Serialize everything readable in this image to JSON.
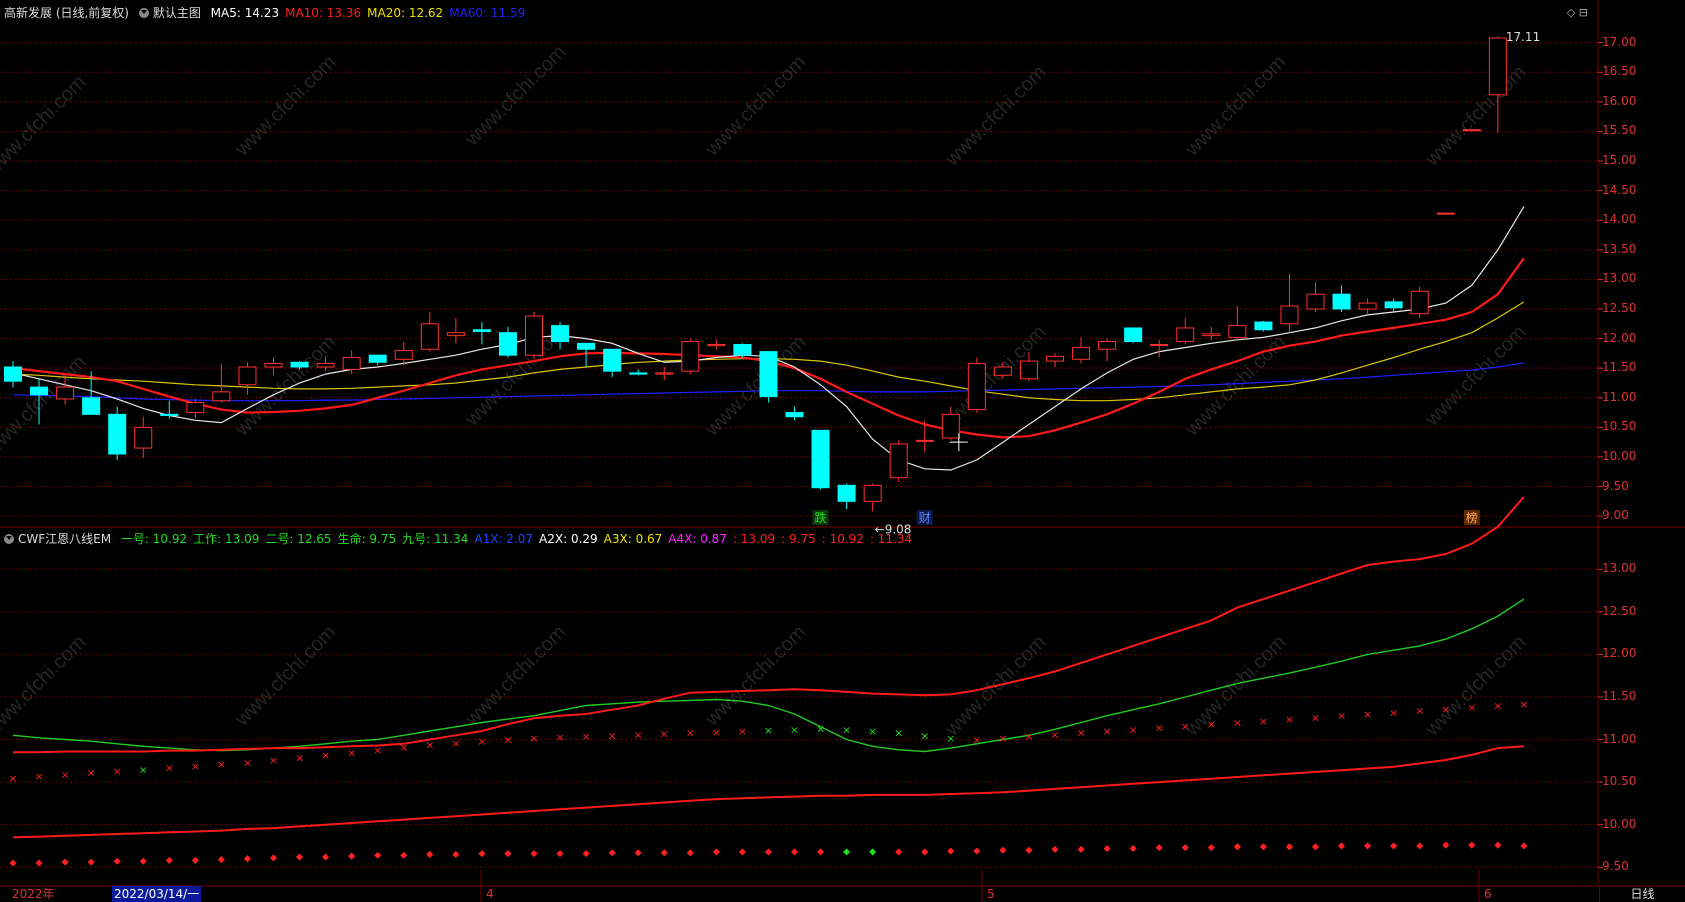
{
  "main": {
    "title": "高新发展 (日线,前复权)",
    "chart_name": "默认主图",
    "ma": [
      {
        "label": "MA5: 14.23",
        "color": "#ffffff"
      },
      {
        "label": "MA10: 13.36",
        "color": "#ff2020"
      },
      {
        "label": "MA20: 12.62",
        "color": "#f0e000"
      },
      {
        "label": "MA60: 11.59",
        "color": "#2020ff"
      }
    ],
    "high_label": "17.11",
    "low_label": "←9.08",
    "markers": [
      "跌",
      "财",
      "榜"
    ],
    "y_ticks": [
      "17.00",
      "16.50",
      "16.00",
      "15.50",
      "15.00",
      "14.50",
      "14.00",
      "13.50",
      "13.00",
      "12.50",
      "12.00",
      "11.50",
      "11.00",
      "10.50",
      "10.00",
      "9.50",
      "9.00"
    ]
  },
  "indicator": {
    "name": "CWF江恩八线EM",
    "values": [
      {
        "label": "一号: 10.92",
        "color": "#22dd22"
      },
      {
        "label": "工作: 13.09",
        "color": "#22dd22"
      },
      {
        "label": "二号: 12.65",
        "color": "#22dd22"
      },
      {
        "label": "生命: 9.75",
        "color": "#22dd22"
      },
      {
        "label": "九号: 11.34",
        "color": "#22dd22"
      },
      {
        "label": "A1X: 2.07",
        "color": "#2244ff"
      },
      {
        "label": "A2X: 0.29",
        "color": "#ffffff"
      },
      {
        "label": "A3X: 0.67",
        "color": "#f0e000"
      },
      {
        "label": "A4X: 0.87",
        "color": "#ff22ff"
      },
      {
        "label": ": 13.09",
        "color": "#ff2020"
      },
      {
        "label": ": 9.75",
        "color": "#ff2020"
      },
      {
        "label": ": 10.92",
        "color": "#ff2020"
      },
      {
        "label": ": 11.34",
        "color": "#ff2020"
      }
    ],
    "y_ticks": [
      "13.00",
      "12.50",
      "12.00",
      "11.50",
      "11.00",
      "10.50",
      "10.00",
      "9.50"
    ]
  },
  "x_axis": {
    "labels": [
      "2022年",
      "2022/03/14/一",
      "4",
      "5",
      "6"
    ],
    "period": "日线"
  },
  "watermark": "www.cfchi.com",
  "colors": {
    "up": "#ff3030",
    "down": "#00ffff",
    "grid": "#7a0000",
    "axis_text": "#d33333"
  },
  "chart_data": {
    "type": "candlestick",
    "candles": [
      {
        "o": 11.52,
        "h": 11.62,
        "l": 11.18,
        "c": 11.28
      },
      {
        "o": 11.18,
        "h": 11.32,
        "l": 10.55,
        "c": 11.05
      },
      {
        "o": 10.98,
        "h": 11.38,
        "l": 10.88,
        "c": 11.18
      },
      {
        "o": 11.0,
        "h": 11.45,
        "l": 10.98,
        "c": 10.72
      },
      {
        "o": 10.72,
        "h": 10.85,
        "l": 9.95,
        "c": 10.05
      },
      {
        "o": 10.15,
        "h": 10.68,
        "l": 9.98,
        "c": 10.5
      },
      {
        "o": 10.72,
        "h": 10.95,
        "l": 10.65,
        "c": 10.7
      },
      {
        "o": 10.75,
        "h": 10.98,
        "l": 10.65,
        "c": 10.92
      },
      {
        "o": 10.95,
        "h": 11.58,
        "l": 10.92,
        "c": 11.1
      },
      {
        "o": 11.22,
        "h": 11.6,
        "l": 11.05,
        "c": 11.52
      },
      {
        "o": 11.52,
        "h": 11.68,
        "l": 11.38,
        "c": 11.58
      },
      {
        "o": 11.6,
        "h": 11.62,
        "l": 11.48,
        "c": 11.52
      },
      {
        "o": 11.52,
        "h": 11.7,
        "l": 11.45,
        "c": 11.58
      },
      {
        "o": 11.48,
        "h": 11.8,
        "l": 11.4,
        "c": 11.68
      },
      {
        "o": 11.72,
        "h": 11.7,
        "l": 11.55,
        "c": 11.6
      },
      {
        "o": 11.65,
        "h": 11.95,
        "l": 11.55,
        "c": 11.8
      },
      {
        "o": 11.82,
        "h": 12.45,
        "l": 11.78,
        "c": 12.25
      },
      {
        "o": 12.05,
        "h": 12.35,
        "l": 11.92,
        "c": 12.1
      },
      {
        "o": 12.15,
        "h": 12.28,
        "l": 11.9,
        "c": 12.12
      },
      {
        "o": 12.1,
        "h": 12.2,
        "l": 11.68,
        "c": 11.72
      },
      {
        "o": 11.72,
        "h": 12.45,
        "l": 11.65,
        "c": 12.38
      },
      {
        "o": 12.22,
        "h": 12.28,
        "l": 11.82,
        "c": 11.95
      },
      {
        "o": 11.92,
        "h": 11.9,
        "l": 11.52,
        "c": 11.82
      },
      {
        "o": 11.82,
        "h": 11.75,
        "l": 11.35,
        "c": 11.45
      },
      {
        "o": 11.42,
        "h": 11.48,
        "l": 11.38,
        "c": 11.4
      },
      {
        "o": 11.4,
        "h": 11.52,
        "l": 11.3,
        "c": 11.42
      },
      {
        "o": 11.45,
        "h": 12.0,
        "l": 11.4,
        "c": 11.95
      },
      {
        "o": 11.88,
        "h": 11.98,
        "l": 11.82,
        "c": 11.9
      },
      {
        "o": 11.9,
        "h": 11.92,
        "l": 11.68,
        "c": 11.72
      },
      {
        "o": 11.78,
        "h": 11.78,
        "l": 10.92,
        "c": 11.02
      },
      {
        "o": 10.75,
        "h": 10.85,
        "l": 10.62,
        "c": 10.68
      },
      {
        "o": 10.45,
        "h": 10.45,
        "l": 9.45,
        "c": 9.48
      },
      {
        "o": 9.52,
        "h": 9.55,
        "l": 9.12,
        "c": 9.25
      },
      {
        "o": 9.25,
        "h": 9.55,
        "l": 9.08,
        "c": 9.52
      },
      {
        "o": 9.65,
        "h": 10.28,
        "l": 9.58,
        "c": 10.22
      },
      {
        "o": 10.28,
        "h": 10.62,
        "l": 10.08,
        "c": 10.28
      },
      {
        "o": 10.32,
        "h": 10.85,
        "l": 10.28,
        "c": 10.72
      },
      {
        "o": 10.8,
        "h": 11.68,
        "l": 10.75,
        "c": 11.58
      },
      {
        "o": 11.38,
        "h": 11.6,
        "l": 11.32,
        "c": 11.52
      },
      {
        "o": 11.32,
        "h": 11.78,
        "l": 11.28,
        "c": 11.62
      },
      {
        "o": 11.62,
        "h": 11.75,
        "l": 11.52,
        "c": 11.7
      },
      {
        "o": 11.65,
        "h": 12.02,
        "l": 11.58,
        "c": 11.85
      },
      {
        "o": 11.82,
        "h": 12.0,
        "l": 11.62,
        "c": 11.95
      },
      {
        "o": 12.18,
        "h": 12.18,
        "l": 11.92,
        "c": 11.95
      },
      {
        "o": 11.9,
        "h": 11.98,
        "l": 11.68,
        "c": 11.9
      },
      {
        "o": 11.95,
        "h": 12.35,
        "l": 11.9,
        "c": 12.18
      },
      {
        "o": 12.05,
        "h": 12.2,
        "l": 11.98,
        "c": 12.08
      },
      {
        "o": 12.02,
        "h": 12.55,
        "l": 11.98,
        "c": 12.22
      },
      {
        "o": 12.28,
        "h": 12.3,
        "l": 12.12,
        "c": 12.15
      },
      {
        "o": 12.25,
        "h": 13.1,
        "l": 12.1,
        "c": 12.55
      },
      {
        "o": 12.5,
        "h": 12.95,
        "l": 12.45,
        "c": 12.75
      },
      {
        "o": 12.75,
        "h": 12.9,
        "l": 12.45,
        "c": 12.5
      },
      {
        "o": 12.5,
        "h": 12.68,
        "l": 12.4,
        "c": 12.6
      },
      {
        "o": 12.62,
        "h": 12.68,
        "l": 12.45,
        "c": 12.52
      },
      {
        "o": 12.42,
        "h": 12.88,
        "l": 12.35,
        "c": 12.8
      },
      {
        "o": 14.12,
        "h": 14.12,
        "l": 14.12,
        "c": 14.12
      },
      {
        "o": 15.53,
        "h": 15.53,
        "l": 15.53,
        "c": 15.53
      },
      {
        "o": 16.12,
        "h": 17.11,
        "l": 15.47,
        "c": 17.08
      }
    ],
    "ma5": [
      11.42,
      11.32,
      11.22,
      11.12,
      10.98,
      10.82,
      10.7,
      10.62,
      10.58,
      10.82,
      11.05,
      11.25,
      11.4,
      11.48,
      11.52,
      11.58,
      11.65,
      11.72,
      11.82,
      11.9,
      12.02,
      12.05,
      12.0,
      11.92,
      11.75,
      11.6,
      11.62,
      11.68,
      11.72,
      11.7,
      11.52,
      11.22,
      10.85,
      10.3,
      9.95,
      9.8,
      9.78,
      9.95,
      10.25,
      10.55,
      10.85,
      11.15,
      11.42,
      11.65,
      11.78,
      11.85,
      11.92,
      11.98,
      12.02,
      12.1,
      12.18,
      12.3,
      12.4,
      12.45,
      12.5,
      12.6,
      12.9,
      13.5,
      14.23
    ],
    "ma10": [
      11.5,
      11.45,
      11.4,
      11.35,
      11.28,
      11.15,
      11.02,
      10.9,
      10.8,
      10.75,
      10.76,
      10.78,
      10.82,
      10.88,
      11.0,
      11.12,
      11.25,
      11.38,
      11.48,
      11.55,
      11.62,
      11.7,
      11.75,
      11.76,
      11.75,
      11.74,
      11.72,
      11.7,
      11.68,
      11.62,
      11.5,
      11.32,
      11.1,
      10.9,
      10.7,
      10.55,
      10.45,
      10.38,
      10.33,
      10.35,
      10.45,
      10.58,
      10.72,
      10.9,
      11.1,
      11.32,
      11.48,
      11.62,
      11.78,
      11.88,
      11.95,
      12.05,
      12.12,
      12.18,
      12.25,
      12.32,
      12.45,
      12.75,
      13.36
    ],
    "ma20": [
      11.4,
      11.38,
      11.35,
      11.32,
      11.3,
      11.28,
      11.25,
      11.22,
      11.2,
      11.18,
      11.16,
      11.15,
      11.15,
      11.16,
      11.18,
      11.2,
      11.22,
      11.25,
      11.3,
      11.35,
      11.42,
      11.48,
      11.52,
      11.56,
      11.6,
      11.62,
      11.64,
      11.65,
      11.66,
      11.66,
      11.65,
      11.62,
      11.55,
      11.45,
      11.35,
      11.28,
      11.2,
      11.12,
      11.06,
      11.0,
      10.97,
      10.95,
      10.95,
      10.97,
      11.0,
      11.05,
      11.1,
      11.15,
      11.18,
      11.22,
      11.3,
      11.42,
      11.55,
      11.68,
      11.82,
      11.95,
      12.1,
      12.35,
      12.62
    ],
    "ma60": [
      11.05,
      11.04,
      11.03,
      11.02,
      11.0,
      10.98,
      10.97,
      10.96,
      10.95,
      10.95,
      10.95,
      10.95,
      10.96,
      10.96,
      10.97,
      10.98,
      10.99,
      11.0,
      11.01,
      11.02,
      11.03,
      11.04,
      11.05,
      11.06,
      11.07,
      11.08,
      11.09,
      11.1,
      11.11,
      11.12,
      11.12,
      11.12,
      11.11,
      11.1,
      11.1,
      11.1,
      11.11,
      11.12,
      11.13,
      11.14,
      11.15,
      11.16,
      11.17,
      11.18,
      11.19,
      11.2,
      11.22,
      11.24,
      11.26,
      11.28,
      11.3,
      11.32,
      11.35,
      11.38,
      11.41,
      11.44,
      11.47,
      11.52,
      11.59
    ],
    "ind_red": [
      10.85,
      10.85,
      10.86,
      10.86,
      10.86,
      10.86,
      10.87,
      10.87,
      10.88,
      10.89,
      10.9,
      10.9,
      10.91,
      10.92,
      10.93,
      10.95,
      11.0,
      11.05,
      11.1,
      11.18,
      11.25,
      11.28,
      11.3,
      11.35,
      11.4,
      11.48,
      11.55,
      11.56,
      11.57,
      11.58,
      11.59,
      11.58,
      11.56,
      11.54,
      11.53,
      11.52,
      11.53,
      11.58,
      11.65,
      11.72,
      11.8,
      11.9,
      12.0,
      12.1,
      12.2,
      12.3,
      12.4,
      12.55,
      12.65,
      12.75,
      12.85,
      12.95,
      13.05,
      13.09,
      13.12,
      13.18,
      13.3,
      13.5,
      13.85
    ],
    "ind_green": [
      11.05,
      11.02,
      11.0,
      10.98,
      10.95,
      10.92,
      10.9,
      10.88,
      10.87,
      10.88,
      10.9,
      10.92,
      10.95,
      10.98,
      11.0,
      11.05,
      11.1,
      11.15,
      11.2,
      11.24,
      11.28,
      11.34,
      11.4,
      11.42,
      11.44,
      11.45,
      11.46,
      11.47,
      11.45,
      11.4,
      11.3,
      11.15,
      11.0,
      10.92,
      10.88,
      10.86,
      10.9,
      10.95,
      11.0,
      11.05,
      11.12,
      11.2,
      11.28,
      11.35,
      11.42,
      11.5,
      11.58,
      11.66,
      11.72,
      11.78,
      11.85,
      11.92,
      12.0,
      12.05,
      12.1,
      12.18,
      12.3,
      12.45,
      12.65
    ],
    "ind_low": [
      9.85,
      9.86,
      9.87,
      9.88,
      9.89,
      9.9,
      9.91,
      9.92,
      9.93,
      9.95,
      9.96,
      9.98,
      10.0,
      10.02,
      10.04,
      10.06,
      10.08,
      10.1,
      10.12,
      10.14,
      10.16,
      10.18,
      10.2,
      10.22,
      10.24,
      10.26,
      10.28,
      10.3,
      10.31,
      10.32,
      10.33,
      10.34,
      10.34,
      10.35,
      10.35,
      10.35,
      10.36,
      10.37,
      10.38,
      10.4,
      10.42,
      10.44,
      10.46,
      10.48,
      10.5,
      10.52,
      10.54,
      10.56,
      10.58,
      10.6,
      10.62,
      10.64,
      10.66,
      10.68,
      10.72,
      10.76,
      10.82,
      10.9,
      10.92
    ],
    "ind_cross": [
      10.55,
      10.57,
      10.59,
      10.61,
      10.63,
      10.65,
      10.67,
      10.69,
      10.71,
      10.73,
      10.76,
      10.79,
      10.82,
      10.85,
      10.88,
      10.91,
      10.94,
      10.96,
      10.98,
      11.0,
      11.02,
      11.03,
      11.04,
      11.05,
      11.06,
      11.07,
      11.08,
      11.09,
      11.1,
      11.11,
      11.12,
      11.13,
      11.12,
      11.1,
      11.08,
      11.05,
      11.02,
      11.0,
      11.02,
      11.04,
      11.06,
      11.08,
      11.1,
      11.12,
      11.14,
      11.16,
      11.18,
      11.2,
      11.22,
      11.24,
      11.26,
      11.28,
      11.3,
      11.32,
      11.34,
      11.36,
      11.38,
      11.4,
      11.42
    ],
    "ind_dots": [
      9.55,
      9.55,
      9.56,
      9.56,
      9.57,
      9.57,
      9.58,
      9.58,
      9.59,
      9.6,
      9.61,
      9.62,
      9.62,
      9.63,
      9.64,
      9.64,
      9.65,
      9.65,
      9.66,
      9.66,
      9.66,
      9.66,
      9.66,
      9.67,
      9.67,
      9.67,
      9.67,
      9.68,
      9.68,
      9.68,
      9.68,
      9.68,
      9.68,
      9.68,
      9.68,
      9.68,
      9.69,
      9.69,
      9.7,
      9.7,
      9.71,
      9.71,
      9.72,
      9.72,
      9.73,
      9.73,
      9.73,
      9.74,
      9.74,
      9.74,
      9.74,
      9.75,
      9.75,
      9.75,
      9.75,
      9.76,
      9.76,
      9.76,
      9.75
    ],
    "ylim_main": [
      8.85,
      17.35
    ],
    "ylim_ind": [
      9.35,
      13.25
    ]
  }
}
